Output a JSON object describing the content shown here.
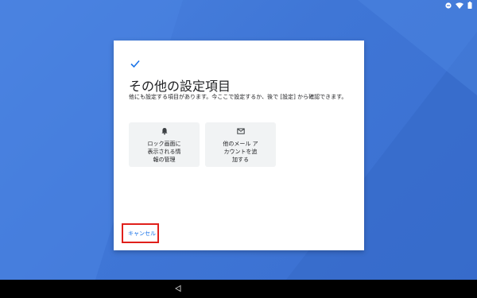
{
  "dialog": {
    "title": "その他の設定項目",
    "description": "他にも設定する項目があります。今ここで設定するか、後で [設定] から確認できます。",
    "options": [
      {
        "label": "ロック画面に\n表示される情\n報の管理",
        "icon": "bell-icon"
      },
      {
        "label": "他のメール ア\nカウントを追\n加する",
        "icon": "mail-icon"
      }
    ],
    "cancel_label": "キャンセル"
  },
  "status_bar": {
    "icons": [
      "dnd-icon",
      "wifi-icon",
      "battery-icon"
    ]
  },
  "nav_bar": {
    "icons": [
      "back-icon"
    ]
  },
  "colors": {
    "accent": "#1a73e8",
    "highlight": "#e0201b",
    "wallpaper": "#3f76d6"
  }
}
